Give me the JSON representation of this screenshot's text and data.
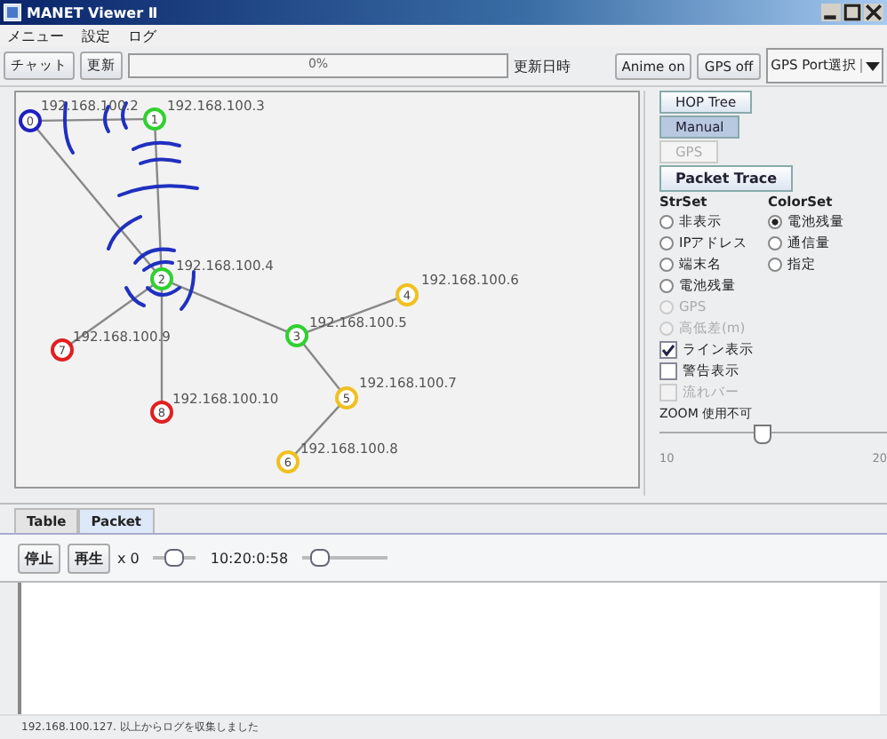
{
  "window": {
    "title": "MANET Viewer Ⅱ"
  },
  "menu": [
    "メニュー",
    "設定",
    "ログ"
  ],
  "toolbar": {
    "left_buttons": [
      "チャット",
      "更新"
    ],
    "progress": {
      "text": "0%"
    },
    "updated_label": "更新日時",
    "right_buttons": [
      "Anime on",
      "GPS off"
    ],
    "port_select": "GPS Port選択"
  },
  "graph": {
    "nodes": [
      {
        "id": "0",
        "ip": "192.168.100.2",
        "color": "#2020c0"
      },
      {
        "id": "1",
        "ip": "192.168.100.3",
        "color": "#30d030"
      },
      {
        "id": "2",
        "ip": "192.168.100.4",
        "color": "#30d030"
      },
      {
        "id": "3",
        "ip": "192.168.100.5",
        "color": "#30d030"
      },
      {
        "id": "4",
        "ip": "192.168.100.6",
        "color": "#f0c020"
      },
      {
        "id": "5",
        "ip": "192.168.100.7",
        "color": "#f0c020"
      },
      {
        "id": "6",
        "ip": "192.168.100.8",
        "color": "#f0c020"
      },
      {
        "id": "7",
        "ip": "192.168.100.9",
        "color": "#e02020"
      },
      {
        "id": "8",
        "ip": "192.168.100.10",
        "color": "#e02020"
      }
    ],
    "kind": "network"
  },
  "side_buttons": [
    {
      "label": "HOP Tree",
      "kind": "toggle",
      "selected": false,
      "disabled": false
    },
    {
      "label": "Manual",
      "kind": "toggle",
      "selected": true,
      "disabled": false
    },
    {
      "label": "GPS",
      "kind": "toggle",
      "selected": false,
      "disabled": true
    },
    {
      "label": "Packet Trace",
      "kind": "action",
      "selected": false,
      "disabled": false
    }
  ],
  "str_set": {
    "title": "StrSet",
    "options": [
      {
        "label": "非表示",
        "selected": false,
        "disabled": false
      },
      {
        "label": "IPアドレス",
        "selected": false,
        "disabled": false
      },
      {
        "label": "端末名",
        "selected": false,
        "disabled": false
      },
      {
        "label": "電池残量",
        "selected": false,
        "disabled": false
      },
      {
        "label": "GPS",
        "selected": false,
        "disabled": true
      },
      {
        "label": "高低差(m)",
        "selected": false,
        "disabled": true
      }
    ]
  },
  "color_set": {
    "title": "ColorSet",
    "options": [
      {
        "label": "電池残量",
        "selected": true
      },
      {
        "label": "通信量",
        "selected": false
      },
      {
        "label": "指定",
        "selected": false
      }
    ]
  },
  "checkboxes": [
    {
      "label": "ライン表示",
      "checked": true,
      "disabled": false
    },
    {
      "label": "警告表示",
      "checked": false,
      "disabled": false
    },
    {
      "label": "流れバー",
      "checked": false,
      "disabled": true
    }
  ],
  "zoom": {
    "label": "ZOOM 使用不可",
    "level": 0.45,
    "min": "10",
    "max": "20"
  },
  "tabs": [
    {
      "label": "Table",
      "selected": false
    },
    {
      "label": "Packet",
      "selected": true
    }
  ],
  "player": {
    "buttons": [
      "停止",
      "再生"
    ],
    "speed": "x 0",
    "speed_slider": {
      "level": 0.5
    },
    "time": "10:20:0:58",
    "time_slider": {
      "level": 0.2
    }
  },
  "status_bar": "192.168.100.127. 以上からログを収集しました"
}
